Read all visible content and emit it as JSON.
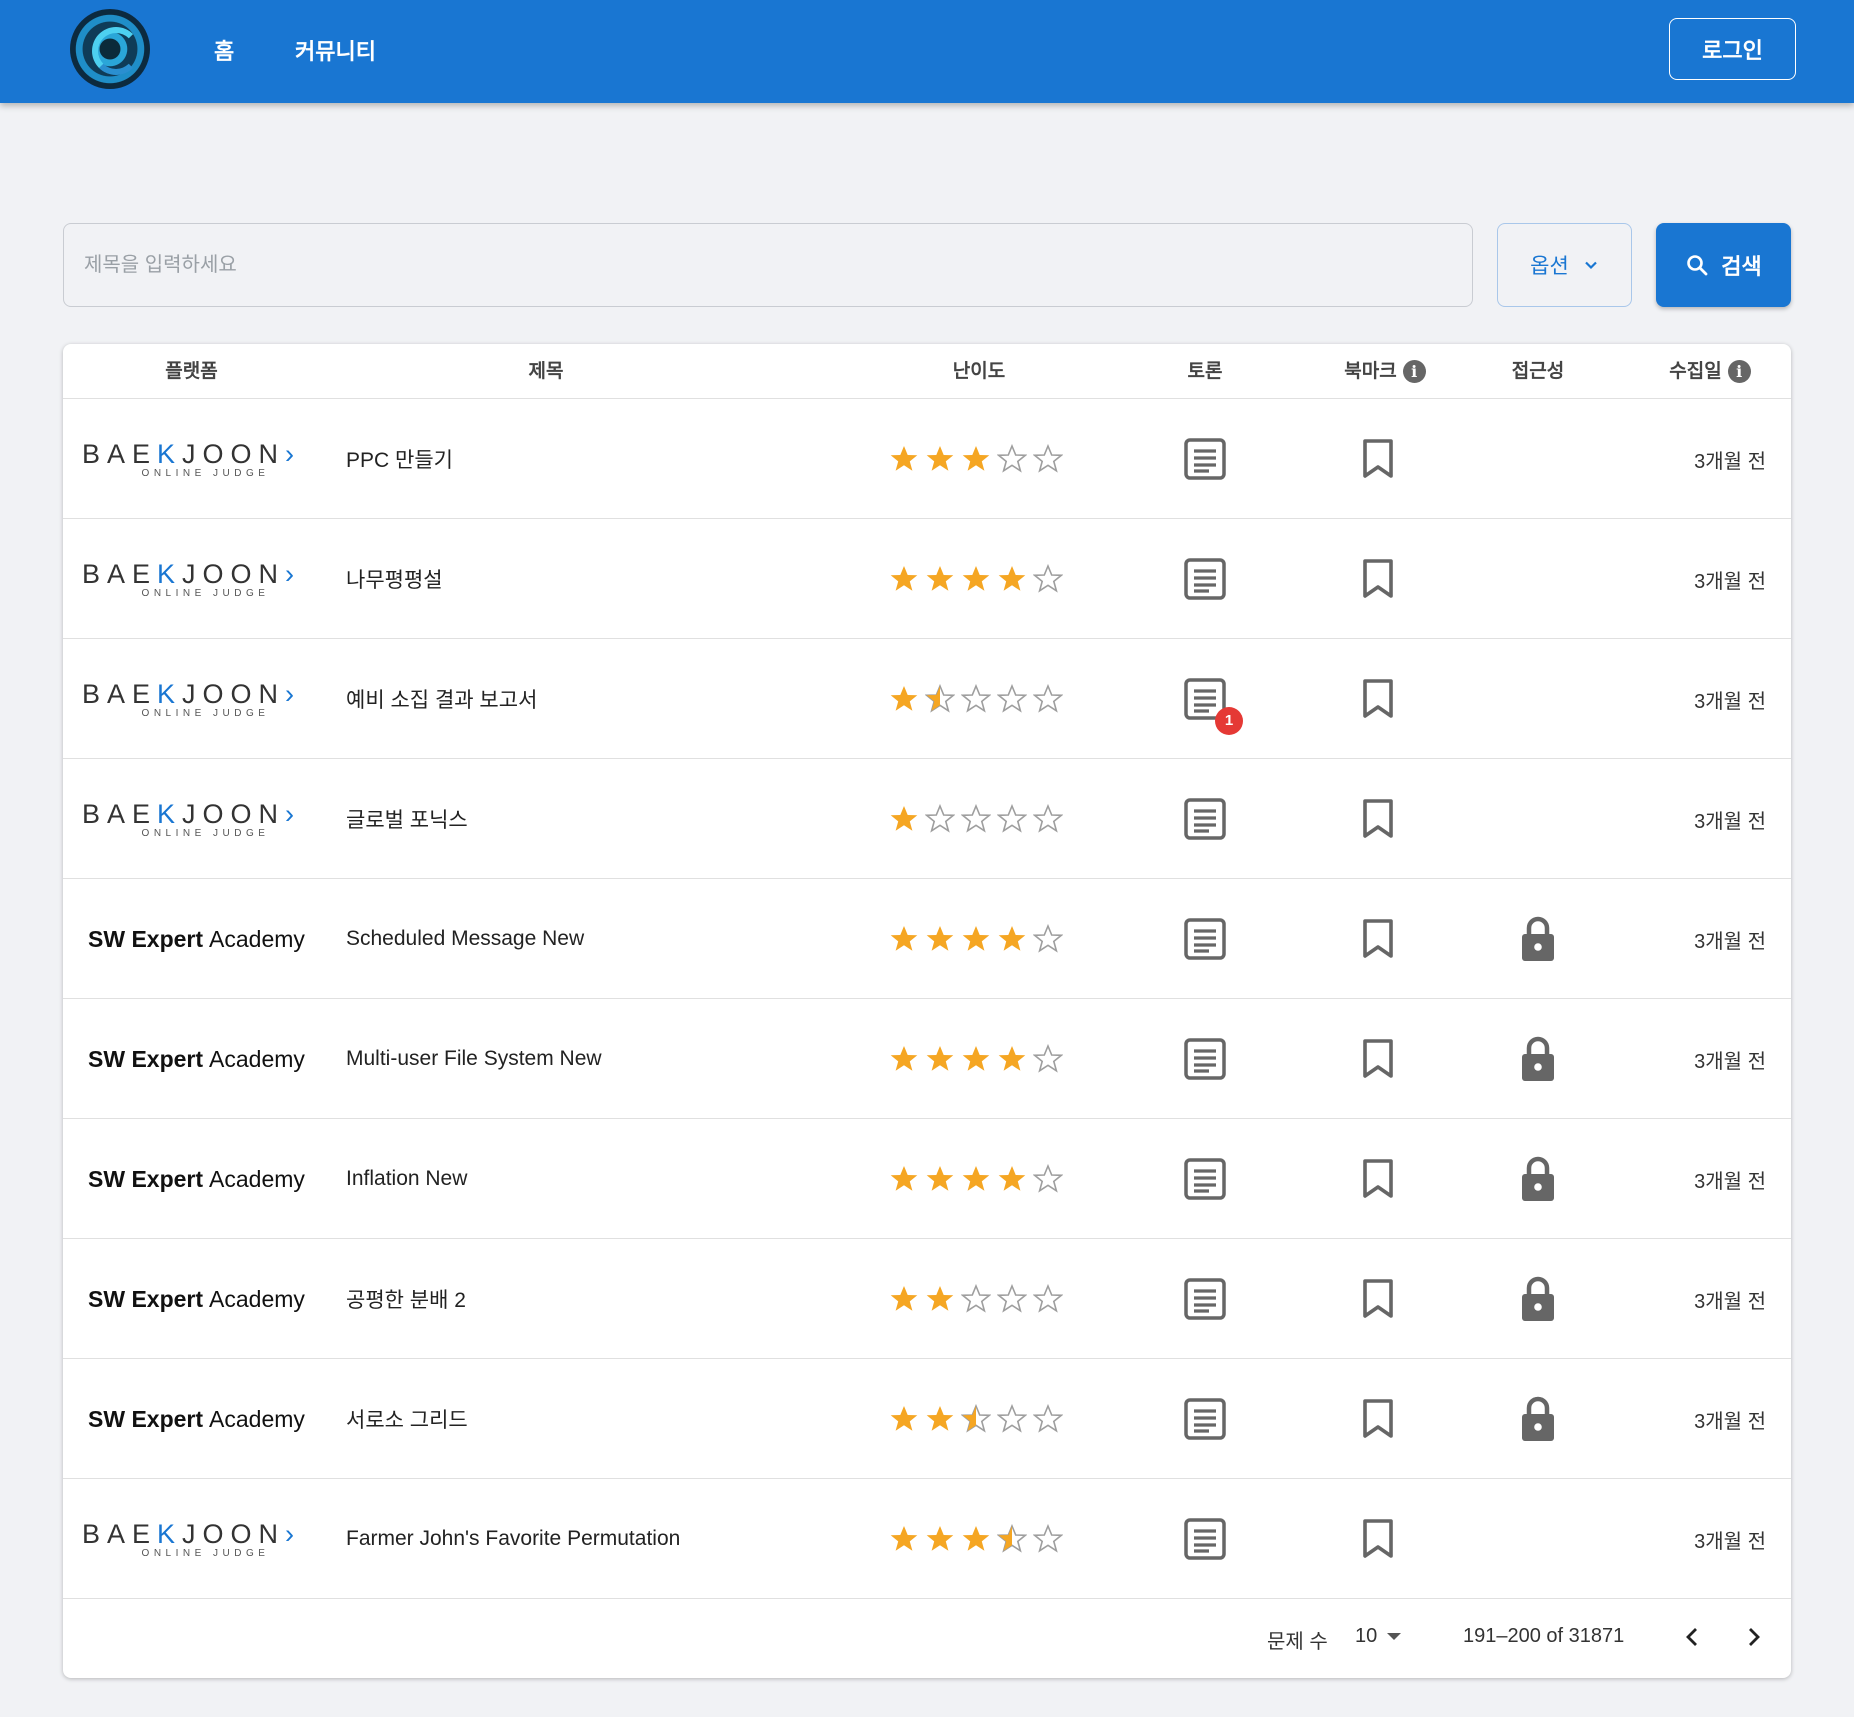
{
  "header": {
    "nav": [
      {
        "label": "홈"
      },
      {
        "label": "커뮤니티"
      }
    ],
    "login_label": "로그인",
    "logo_icon": "app-logo-icon"
  },
  "search": {
    "placeholder": "제목을 입력하세요",
    "options_label": "옵션",
    "search_label": "검색"
  },
  "table": {
    "columns": [
      "플랫폼",
      "제목",
      "난이도",
      "토론",
      "북마크",
      "접근성",
      "수집일"
    ],
    "rows": [
      {
        "platform": "baekjoon",
        "title": "PPC 만들기",
        "difficulty": 3,
        "discussion_count": 0,
        "locked": false,
        "date": "3개월 전"
      },
      {
        "platform": "baekjoon",
        "title": "나무평평설",
        "difficulty": 4,
        "discussion_count": 0,
        "locked": false,
        "date": "3개월 전"
      },
      {
        "platform": "baekjoon",
        "title": "예비 소집 결과 보고서",
        "difficulty": 1.5,
        "discussion_count": 1,
        "locked": false,
        "date": "3개월 전"
      },
      {
        "platform": "baekjoon",
        "title": "글로벌 포닉스",
        "difficulty": 1,
        "discussion_count": 0,
        "locked": false,
        "date": "3개월 전"
      },
      {
        "platform": "swea",
        "title": "Scheduled Message New",
        "difficulty": 4,
        "discussion_count": 0,
        "locked": true,
        "date": "3개월 전"
      },
      {
        "platform": "swea",
        "title": "Multi-user File System New",
        "difficulty": 4,
        "discussion_count": 0,
        "locked": true,
        "date": "3개월 전"
      },
      {
        "platform": "swea",
        "title": "Inflation New",
        "difficulty": 4,
        "discussion_count": 0,
        "locked": true,
        "date": "3개월 전"
      },
      {
        "platform": "swea",
        "title": "공평한 분배 2",
        "difficulty": 2,
        "discussion_count": 0,
        "locked": true,
        "date": "3개월 전"
      },
      {
        "platform": "swea",
        "title": "서로소 그리드",
        "difficulty": 2.5,
        "discussion_count": 0,
        "locked": true,
        "date": "3개월 전"
      },
      {
        "platform": "baekjoon",
        "title": "Farmer John's Favorite Permutation",
        "difficulty": 3.5,
        "discussion_count": 0,
        "locked": false,
        "date": "3개월 전"
      }
    ]
  },
  "platforms": {
    "baekjoon": {
      "main_pre": "BAE",
      "main_accent": "K",
      "main_post": "JOON",
      "accent_end": "›",
      "sub": "ONLINE JUDGE"
    },
    "swea": {
      "bold": "SW Expert",
      "light": "Academy"
    }
  },
  "pagination": {
    "rows_label": "문제 수",
    "rows_per_page": "10",
    "range": "191–200 of 31871"
  },
  "colors": {
    "primary": "#1976d2",
    "star": "#f5a623",
    "badge": "#e53935",
    "icon": "#666666"
  }
}
